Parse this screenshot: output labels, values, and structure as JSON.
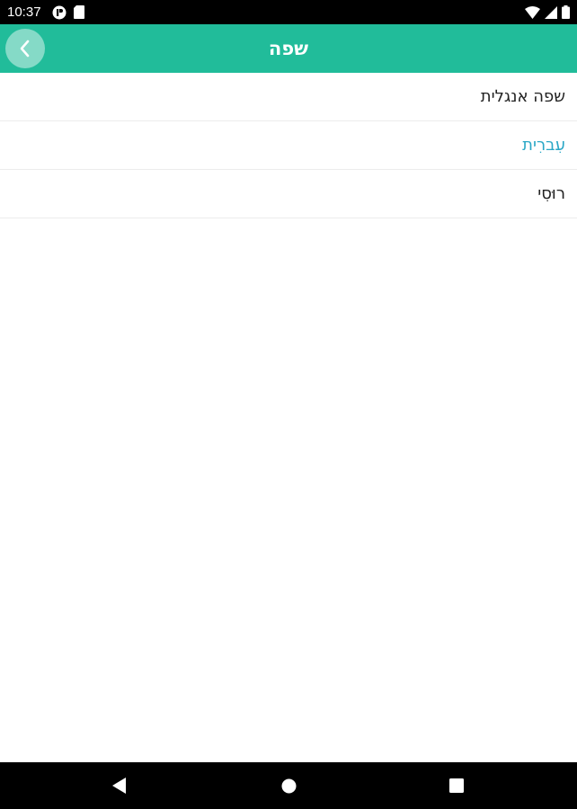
{
  "status_bar": {
    "time": "10:37",
    "left_icons": [
      "notification-app-icon",
      "sd-card-icon"
    ],
    "right_icons": [
      "wifi-icon",
      "cellular-signal-icon",
      "battery-icon"
    ]
  },
  "app_bar": {
    "title": "שפה",
    "back_icon": "chevron-left-icon",
    "color": "#21bc9a"
  },
  "languages": [
    {
      "label": "שפה אנגלית",
      "selected": false
    },
    {
      "label": "עִברִית",
      "selected": true
    },
    {
      "label": "רוּסִי",
      "selected": false
    }
  ],
  "colors": {
    "selected_text": "#2aa7c6",
    "normal_text": "#222222"
  },
  "nav_bar": {
    "buttons": [
      "back-triangle-icon",
      "home-circle-icon",
      "recents-square-icon"
    ]
  }
}
